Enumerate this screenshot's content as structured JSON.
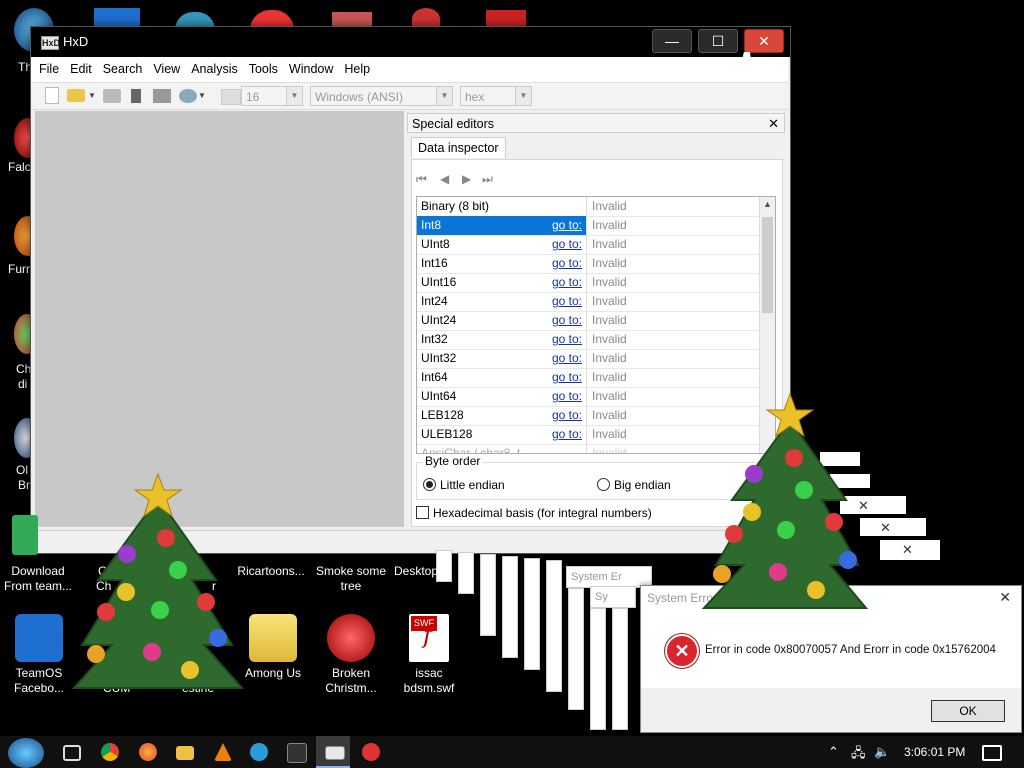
{
  "hxd": {
    "title": "HxD",
    "logo_text": "HxD",
    "menu": [
      "File",
      "Edit",
      "Search",
      "View",
      "Analysis",
      "Tools",
      "Window",
      "Help"
    ],
    "toolbar": {
      "bytes_per_row": "16",
      "charset": "Windows (ANSI)",
      "offset_base": "hex"
    },
    "controls": {
      "minimize": "—",
      "maximize": "☐",
      "close": "✕"
    }
  },
  "special_editors": {
    "title": "Special editors",
    "close": "✕",
    "tab": "Data inspector",
    "nav": [
      "⏮",
      "◀",
      "▶",
      "⏭"
    ],
    "goto_label": "go to:",
    "rows": [
      {
        "type": "Binary (8 bit)",
        "value": "Invalid",
        "goto": false,
        "selected": false
      },
      {
        "type": "Int8",
        "value": "Invalid",
        "goto": true,
        "selected": true
      },
      {
        "type": "UInt8",
        "value": "Invalid",
        "goto": true,
        "selected": false
      },
      {
        "type": "Int16",
        "value": "Invalid",
        "goto": true,
        "selected": false
      },
      {
        "type": "UInt16",
        "value": "Invalid",
        "goto": true,
        "selected": false
      },
      {
        "type": "Int24",
        "value": "Invalid",
        "goto": true,
        "selected": false
      },
      {
        "type": "UInt24",
        "value": "Invalid",
        "goto": true,
        "selected": false
      },
      {
        "type": "Int32",
        "value": "Invalid",
        "goto": true,
        "selected": false
      },
      {
        "type": "UInt32",
        "value": "Invalid",
        "goto": true,
        "selected": false
      },
      {
        "type": "Int64",
        "value": "Invalid",
        "goto": true,
        "selected": false
      },
      {
        "type": "UInt64",
        "value": "Invalid",
        "goto": true,
        "selected": false
      },
      {
        "type": "LEB128",
        "value": "Invalid",
        "goto": true,
        "selected": false
      },
      {
        "type": "ULEB128",
        "value": "Invalid",
        "goto": true,
        "selected": false
      }
    ],
    "byte_order": {
      "label": "Byte order",
      "little": "Little endian",
      "big": "Big endian",
      "selected": "little"
    },
    "hex_basis": "Hexadecimal basis (for integral numbers)"
  },
  "desktop_icons": [
    {
      "name": "Download From team...",
      "line1": "Download",
      "line2": "From team..."
    },
    {
      "name": "TeamOS Facebo...",
      "line1": "TeamOS",
      "line2": "Facebo..."
    },
    {
      "name": "Ricartoons...",
      "line1": "Ricartoons...",
      "line2": ""
    },
    {
      "name": "Smoke some tree",
      "line1": "Smoke some",
      "line2": "tree"
    },
    {
      "name": "Among Us",
      "line1": "Among Us",
      "line2": ""
    },
    {
      "name": "Broken Christm...",
      "line1": "Broken",
      "line2": "Christm..."
    },
    {
      "name": "issac bdsm.swf",
      "line1": "issac",
      "line2": "bdsm.swf"
    }
  ],
  "left_icon_labels": [
    "Th",
    "Falc",
    "Furr",
    "Ch",
    "di",
    "Ol",
    "Br",
    "CHIN",
    "Ch",
    "CUM",
    "estine",
    "r",
    "Desktop"
  ],
  "error_dialog": {
    "title": "System Error",
    "message": "Error in code 0x80070057 And Erorr in code 0x15762004",
    "ok": "OK",
    "ghost_titles": [
      "System Er",
      "Sy"
    ]
  },
  "taskbar": {
    "time": "3:06:01 PM"
  },
  "colors": {
    "selection": "#0a75d8",
    "close_button": "#d9473a",
    "editor_bg": "#c8c8c8",
    "error_red": "#d9262c"
  }
}
